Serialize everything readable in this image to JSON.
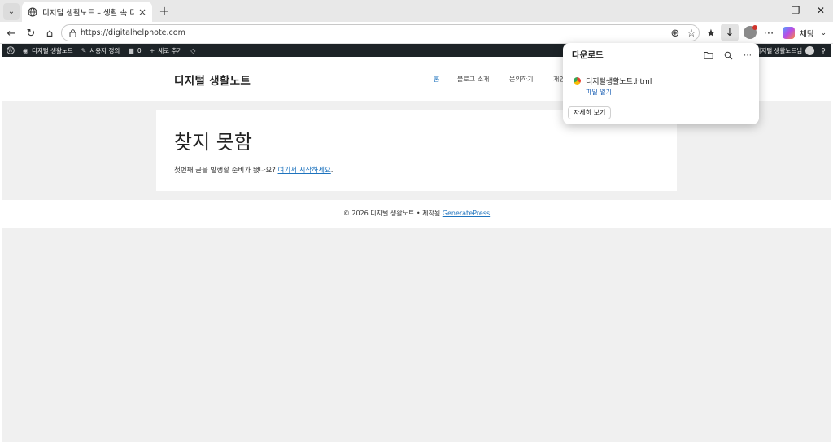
{
  "browser": {
    "tab": {
      "title": "디지털 생활노트 – 생활 속 디지털"
    },
    "address": {
      "url": "https://digitalhelpnote.com"
    },
    "copilot_label": "채팅"
  },
  "adminbar": {
    "site_name": "디지털 생활노트",
    "customize": "사용자 정의",
    "comments_count": "0",
    "new_content": "새로 추가",
    "greeting": "디지털 생활노트님"
  },
  "site": {
    "title": "디지털 생활노트",
    "nav": [
      "홈",
      "블로그 소개",
      "문의하기",
      "개인"
    ]
  },
  "content": {
    "heading": "찾지 못함",
    "text": "첫번째 글을 발행할 준비가 됐나요? ",
    "link": "여기서 시작하세요",
    "suffix": "."
  },
  "footer": {
    "text": "© 2026 디지털 생활노트 • 제작됨 ",
    "link": "GeneratePress"
  },
  "downloads": {
    "title": "다운로드",
    "file_name": "디지털생활노트.html",
    "open_label": "파일 열기",
    "more_label": "자세히 보기"
  }
}
